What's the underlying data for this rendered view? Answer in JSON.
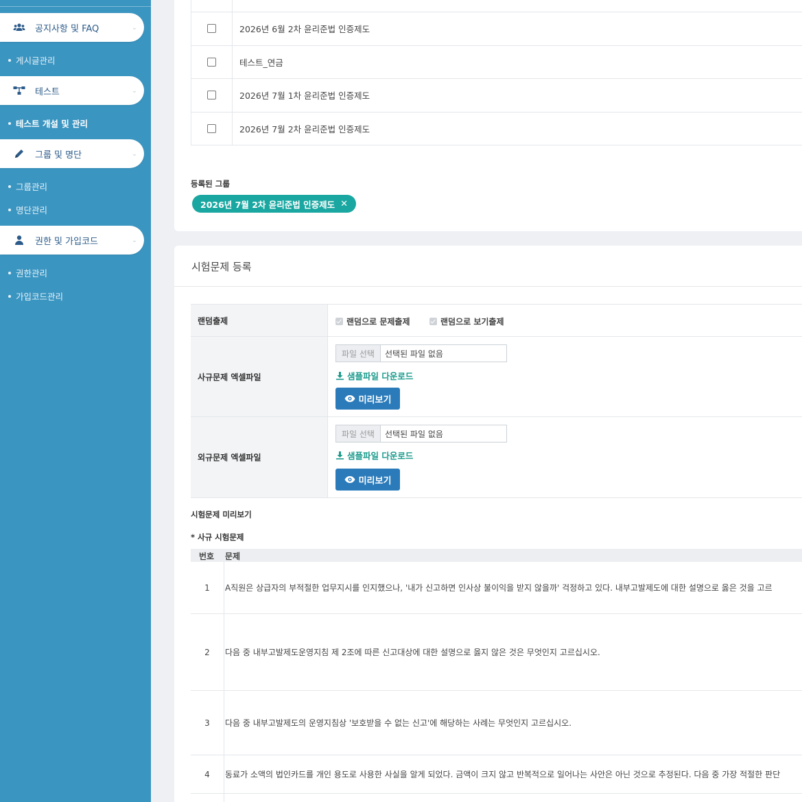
{
  "sidebar": {
    "menus": [
      {
        "label": "공지사항 및 FAQ",
        "icon": "users-icon"
      },
      {
        "label": "테스트",
        "icon": "sitemap-icon"
      },
      {
        "label": "그룹 및 명단",
        "icon": "pencil-icon"
      },
      {
        "label": "권한 및 가입코드",
        "icon": "user-icon"
      }
    ],
    "subitems": {
      "notice": [
        "게시글관리"
      ],
      "test": [
        "테스트 개설 및 관리"
      ],
      "group": [
        "그룹관리",
        "명단관리"
      ],
      "auth": [
        "권한관리",
        "가입코드관리"
      ]
    }
  },
  "group_list": {
    "rows": [
      "2026년 6월 2차 윤리준법 인증제도",
      "테스트_연금",
      "2026년 7월 1차 윤리준법 인증제도",
      "2026년 7월 2차 윤리준법 인증제도"
    ],
    "registered_label": "등록된 그룹",
    "registered_tag": "2026년 7월 2차 윤리준법 인증제도",
    "tag_remove": "✕"
  },
  "exam": {
    "title": "시험문제 등록",
    "random_label": "랜덤출제",
    "random_options": [
      "랜덤으로 문제출제",
      "랜덤으로 보기출제"
    ],
    "internal_label": "사규문제 엑셀파일",
    "external_label": "외규문제 엑셀파일",
    "file_button": "파일 선택",
    "file_none": "선택된 파일 없음",
    "sample_download": "샘플파일 다운로드",
    "preview_button": "미리보기",
    "preview_title": "시험문제 미리보기",
    "internal_preview_title": "* 사규 시험문제",
    "columns": {
      "no": "번호",
      "question": "문제"
    },
    "questions": [
      {
        "no": "1",
        "text": "A직원은 상급자의 부적절한 업무지시를 인지했으나, '내가 신고하면 인사상 불이익을 받지 않을까' 걱정하고 있다. 내부고발제도에 대한 설명으로 옳은 것을 고르"
      },
      {
        "no": "2",
        "text": "다음 중 내부고발제도운영지침 제 2조에 따른 신고대상에 대한 설명으로 옳지 않은 것은 무엇인지 고르십시오."
      },
      {
        "no": "3",
        "text": "다음 중 내부고발제도의 운영지침상 '보호받을 수 없는 신고'에 해당하는 사례는 무엇인지 고르십시오."
      },
      {
        "no": "4",
        "text": "동료가 소액의 법인카드를 개인 용도로 사용한 사실을 알게 되었다. 금액이 크지 않고 반복적으로 일어나는 사안은 아닌 것으로 추정된다. 다음 중 가장 적절한 판단"
      }
    ]
  },
  "colors": {
    "sidebar": "#3b95c1",
    "tag": "#1aa7a1",
    "primary_button": "#2b7bba",
    "link": "#1a9a8c"
  }
}
